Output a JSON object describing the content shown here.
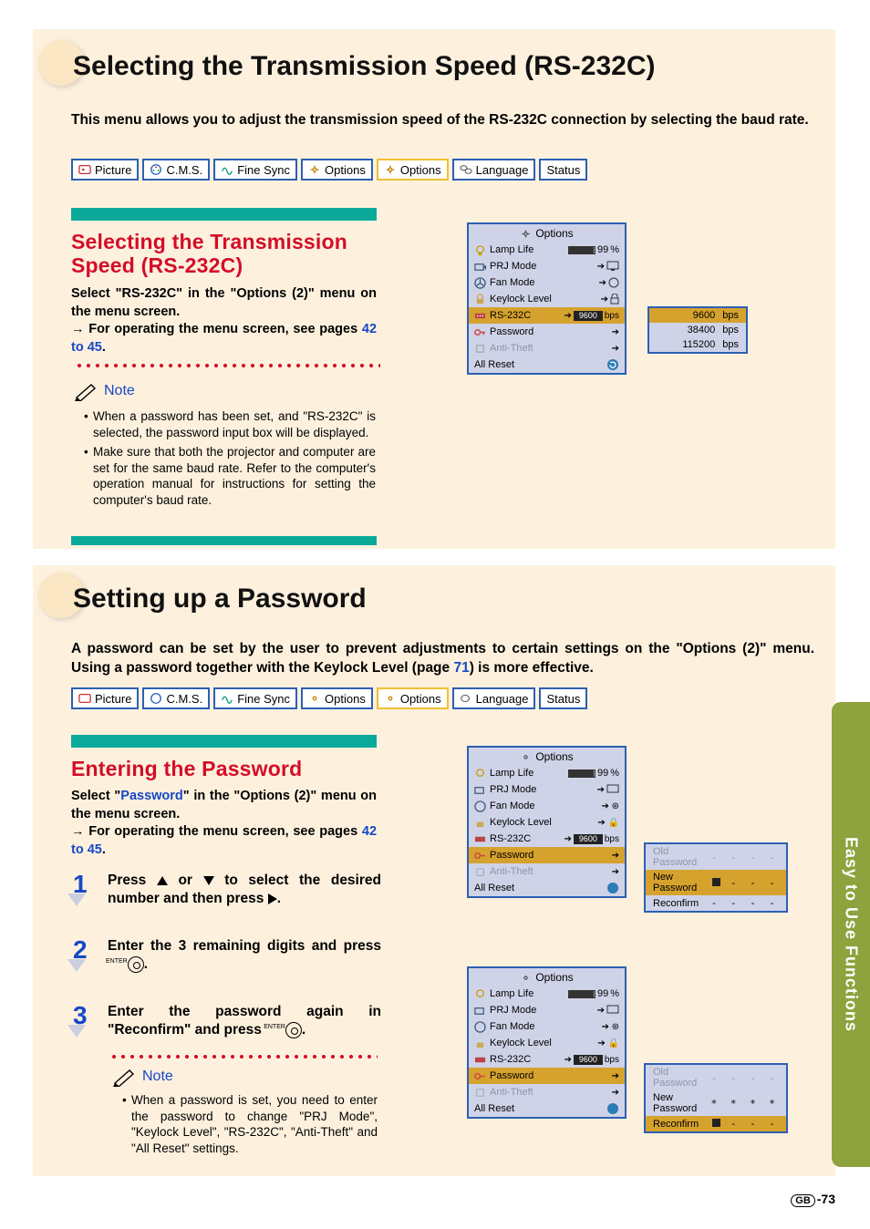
{
  "section1": {
    "title": "Selecting the Transmission Speed (RS-232C)",
    "intro": "This menu allows you to adjust the transmission speed of the RS-232C connection by selecting the baud rate.",
    "subTitle": "Selecting the Transmission Speed (RS-232C)",
    "body1a": "Select \"RS-232C\" in the \"Options (2)\" menu on the menu screen.",
    "body1b": "For operating the menu screen, see pages ",
    "body1c": "42 to 45",
    "body1d": ".",
    "noteLabel": "Note",
    "notes": [
      "When a password has been set, and \"RS-232C\" is selected, the password input box will be displayed.",
      "Make sure that both the projector and computer are set for the same baud rate. Refer to the computer's operation manual for instructions for setting the computer's baud rate."
    ]
  },
  "section2": {
    "title": "Setting up a Password",
    "introA": "A password can be set by the user to prevent adjustments to certain settings on the \"Options (2)\" menu. Using a password together with the Keylock Level (page ",
    "introLink": "71",
    "introB": ") is more effective.",
    "subTitle": "Entering the Password",
    "body1a": "Select \"",
    "body1link": "Password",
    "body1b": "\" in the \"Options (2)\" menu on the menu screen.",
    "body2": "For operating the menu screen, see pages ",
    "body2link": "42 to 45",
    "body2b": ".",
    "steps": {
      "s1": "Press  ▲  or  ▼  to select the desired number and then press  ▶.",
      "s1_plain_a": "Press ",
      "s1_plain_b": " or ",
      "s1_plain_c": " to select the desired number and then press ",
      "s1_plain_d": ".",
      "s2a": "Enter the 3 remaining digits and press ",
      "s2b": ".",
      "s3a": "Enter the password again in \"Reconfirm\" and press ",
      "s3b": "."
    },
    "noteLabel": "Note",
    "notes": [
      "When a password is set, you need to enter the password to change \"PRJ Mode\", \"Keylock Level\", \"RS-232C\", \"Anti-Theft\" and \"All Reset\" settings."
    ]
  },
  "tabs": {
    "picture": "Picture",
    "cms": "C.M.S.",
    "finesync": "Fine Sync",
    "options1": "Options",
    "options2": "Options",
    "language": "Language",
    "status": "Status"
  },
  "osd": {
    "head": "Options",
    "lampLife": "Lamp Life",
    "lampVal": "99",
    "lampPct": "%",
    "prj": "PRJ Mode",
    "fan": "Fan Mode",
    "keylock": "Keylock Level",
    "rs232": "RS-232C",
    "rsval": "9600",
    "bps": "bps",
    "password": "Password",
    "anti": "Anti-Theft",
    "reset": "All Reset"
  },
  "baud": {
    "b1": "9600",
    "b2": "38400",
    "b3": "115200",
    "bps": "bps"
  },
  "pwdPanel": {
    "old": "Old Password",
    "new": "New Password",
    "rec": "Reconfirm",
    "dashes": "- - - -",
    "stars": "* * * *"
  },
  "sideTab": "Easy to Use Functions",
  "pageNum": {
    "code": "GB",
    "num": "-73"
  }
}
